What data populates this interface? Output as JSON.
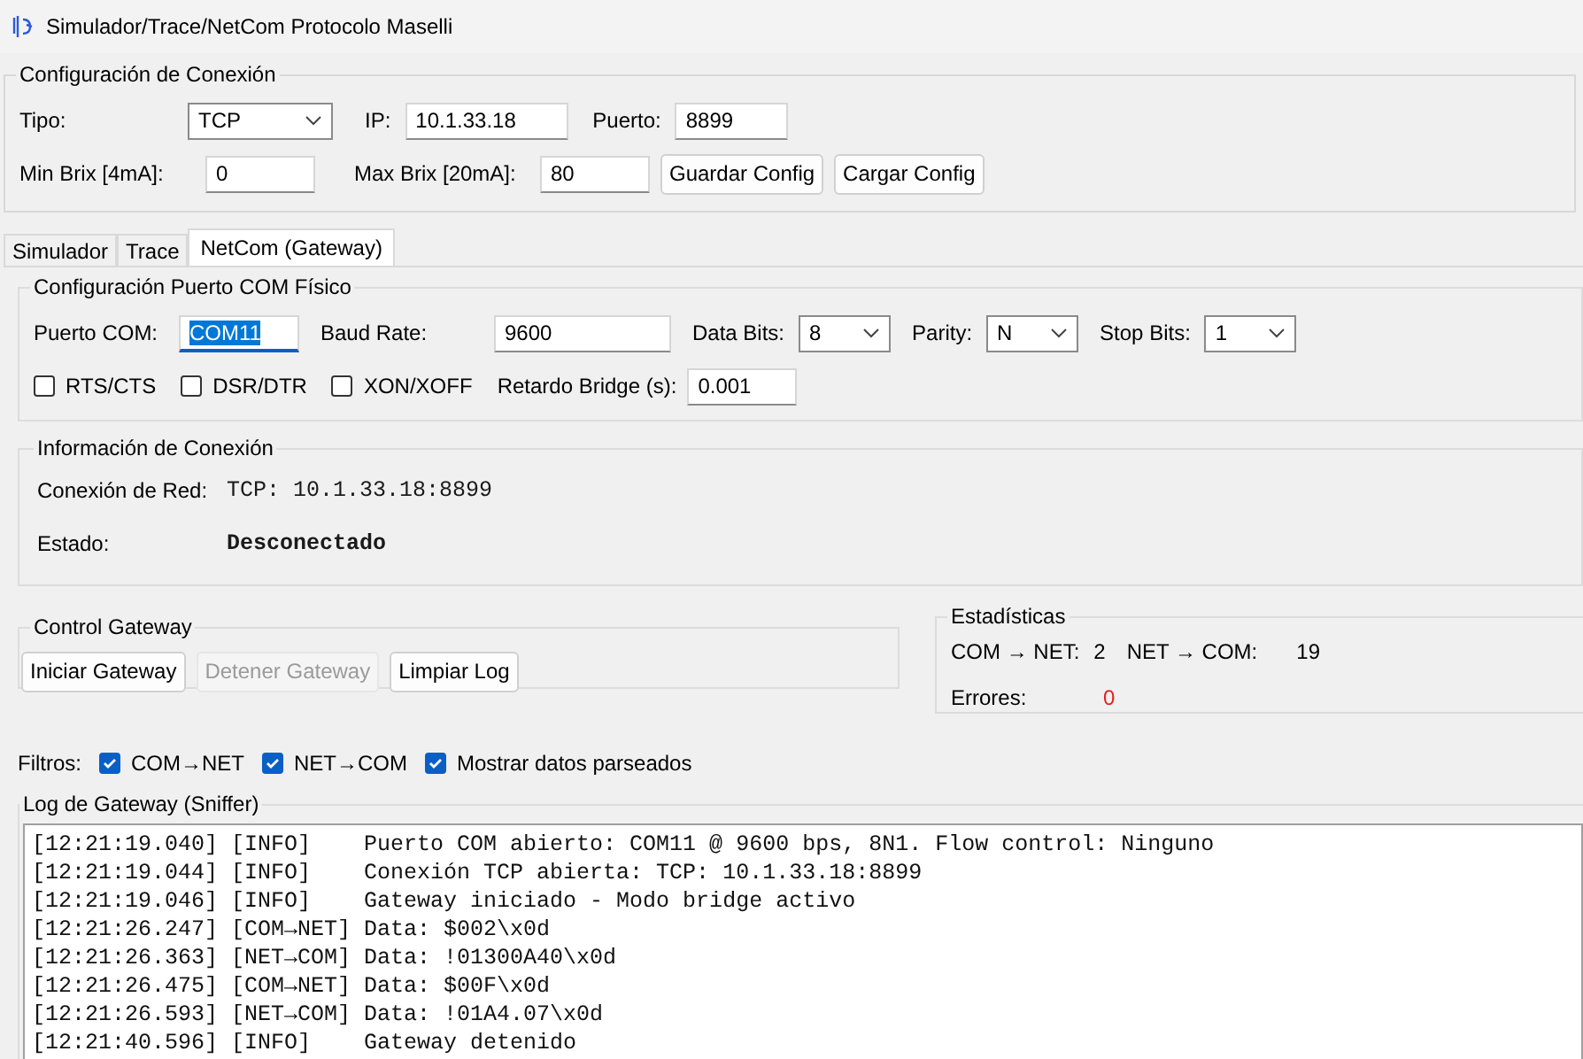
{
  "window": {
    "title": "Simulador/Trace/NetCom Protocolo Maselli"
  },
  "connection": {
    "title": "Configuración de Conexión",
    "type_label": "Tipo:",
    "type_value": "TCP",
    "ip_label": "IP:",
    "ip_value": "10.1.33.18",
    "port_label": "Puerto:",
    "port_value": "8899",
    "min_label": "Min Brix [4mA]:",
    "min_value": "0",
    "max_label": "Max Brix [20mA]:",
    "max_value": "80",
    "buttons": [
      "Guardar Config",
      "Cargar Config"
    ]
  },
  "tabs": [
    {
      "label": "Simulador",
      "selected": false
    },
    {
      "label": "Trace",
      "selected": false
    },
    {
      "label": "NetCom (Gateway)",
      "selected": true
    }
  ],
  "com_config": {
    "title": "Configuración Puerto COM Físico",
    "port_label": "Puerto COM:",
    "port_value": "COM11",
    "port_focused": true,
    "baud_label": "Baud Rate:",
    "baud_value": "9600",
    "combos": [
      {
        "label": "Data Bits:",
        "value": "8"
      },
      {
        "label": "Parity:",
        "value": "N"
      },
      {
        "label": "Stop Bits:",
        "value": "1"
      }
    ],
    "flow": [
      {
        "label": "RTS/CTS",
        "checked": false
      },
      {
        "label": "DSR/DTR",
        "checked": false
      },
      {
        "label": "XON/XOFF",
        "checked": false
      }
    ],
    "delay_label": "Retardo Bridge (s):",
    "delay_value": "0.001"
  },
  "info": {
    "title": "Información de Conexión",
    "rows": [
      {
        "label": "Conexión de Red:",
        "value": "TCP: 10.1.33.18:8899",
        "bold": false
      },
      {
        "label": "Estado:",
        "value": "Desconectado",
        "bold": true
      }
    ]
  },
  "control": {
    "title": "Control Gateway",
    "buttons": [
      {
        "label": "Iniciar Gateway",
        "disabled": false
      },
      {
        "label": "Detener Gateway",
        "disabled": true
      },
      {
        "label": "Limpiar Log",
        "disabled": false
      }
    ]
  },
  "stats": {
    "title": "Estadísticas",
    "com_net_label": "COM → NET:",
    "com_net_value": "2",
    "net_com_label": "NET → COM:",
    "net_com_value": "19",
    "errors_label": "Errores:",
    "errors_value": "0"
  },
  "filters": {
    "label": "Filtros:",
    "items": [
      {
        "label": "COM→NET",
        "checked": true
      },
      {
        "label": "NET→COM",
        "checked": true
      },
      {
        "label": "Mostrar datos parseados",
        "checked": true
      }
    ]
  },
  "log": {
    "title": "Log de Gateway (Sniffer)",
    "lines": [
      {
        "time": "[12:21:19.040]",
        "tag": "[INFO]",
        "message": "Puerto COM abierto: COM11 @ 9600 bps, 8N1. Flow control: Ninguno"
      },
      {
        "time": "[12:21:19.044]",
        "tag": "[INFO]",
        "message": "Conexión TCP abierta: TCP: 10.1.33.18:8899"
      },
      {
        "time": "[12:21:19.046]",
        "tag": "[INFO]",
        "message": "Gateway iniciado - Modo bridge activo"
      },
      {
        "time": "[12:21:26.247]",
        "tag": "[COM→NET]",
        "message": "Data: $002\\x0d"
      },
      {
        "time": "[12:21:26.363]",
        "tag": "[NET→COM]",
        "message": "Data: !01300A40\\x0d"
      },
      {
        "time": "[12:21:26.475]",
        "tag": "[COM→NET]",
        "message": "Data: $00F\\x0d"
      },
      {
        "time": "[12:21:26.593]",
        "tag": "[NET→COM]",
        "message": "Data: !01A4.07\\x0d"
      },
      {
        "time": "[12:21:40.596]",
        "tag": "[INFO]",
        "message": "Gateway detenido"
      }
    ]
  }
}
